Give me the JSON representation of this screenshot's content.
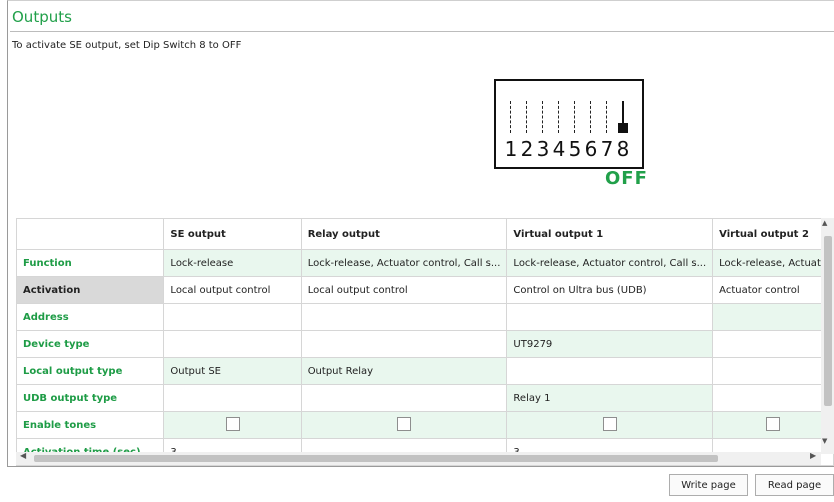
{
  "page": {
    "title": "Outputs",
    "instruction": "To activate SE output, set Dip Switch 8 to OFF"
  },
  "dip_switch": {
    "numbers": [
      "1",
      "2",
      "3",
      "4",
      "5",
      "6",
      "7",
      "8"
    ],
    "highlighted_switch": "8",
    "state": "OFF"
  },
  "table": {
    "columns": [
      "",
      "SE output",
      "Relay output",
      "Virtual output 1",
      "Virtual output 2"
    ],
    "rows": [
      {
        "label": "Function",
        "style": "green",
        "cells": [
          "Lock-release",
          "Lock-release, Actuator control, Call s...",
          "Lock-release, Actuator control, Call s...",
          "Lock-release, Actuato"
        ]
      },
      {
        "label": "Activation",
        "style": "selected",
        "cells": [
          "Local output control",
          "Local output control",
          "Control on Ultra bus (UDB)",
          "Actuator control"
        ]
      },
      {
        "label": "Address",
        "style": "mixed",
        "cells": [
          "",
          "",
          "",
          ""
        ]
      },
      {
        "label": "Device type",
        "style": "mixed",
        "cells": [
          "",
          "",
          "UT9279",
          ""
        ]
      },
      {
        "label": "Local output type",
        "style": "mixed",
        "cells": [
          "Output SE",
          "Output Relay",
          "",
          ""
        ]
      },
      {
        "label": "UDB output type",
        "style": "mixed",
        "cells": [
          "",
          "",
          "Relay 1",
          ""
        ]
      },
      {
        "label": "Enable tones",
        "style": "checkbox",
        "cells": [
          "",
          "",
          "",
          ""
        ]
      },
      {
        "label": "Activation time (sec)",
        "style": "partial",
        "cells": [
          "3",
          "",
          "3",
          ""
        ]
      }
    ]
  },
  "buttons": {
    "write": "Write page",
    "read": "Read page"
  },
  "colors": {
    "accent_green": "#21a04a",
    "row_green": "#e9f7ee",
    "selected_row": "#d9d9d9"
  }
}
